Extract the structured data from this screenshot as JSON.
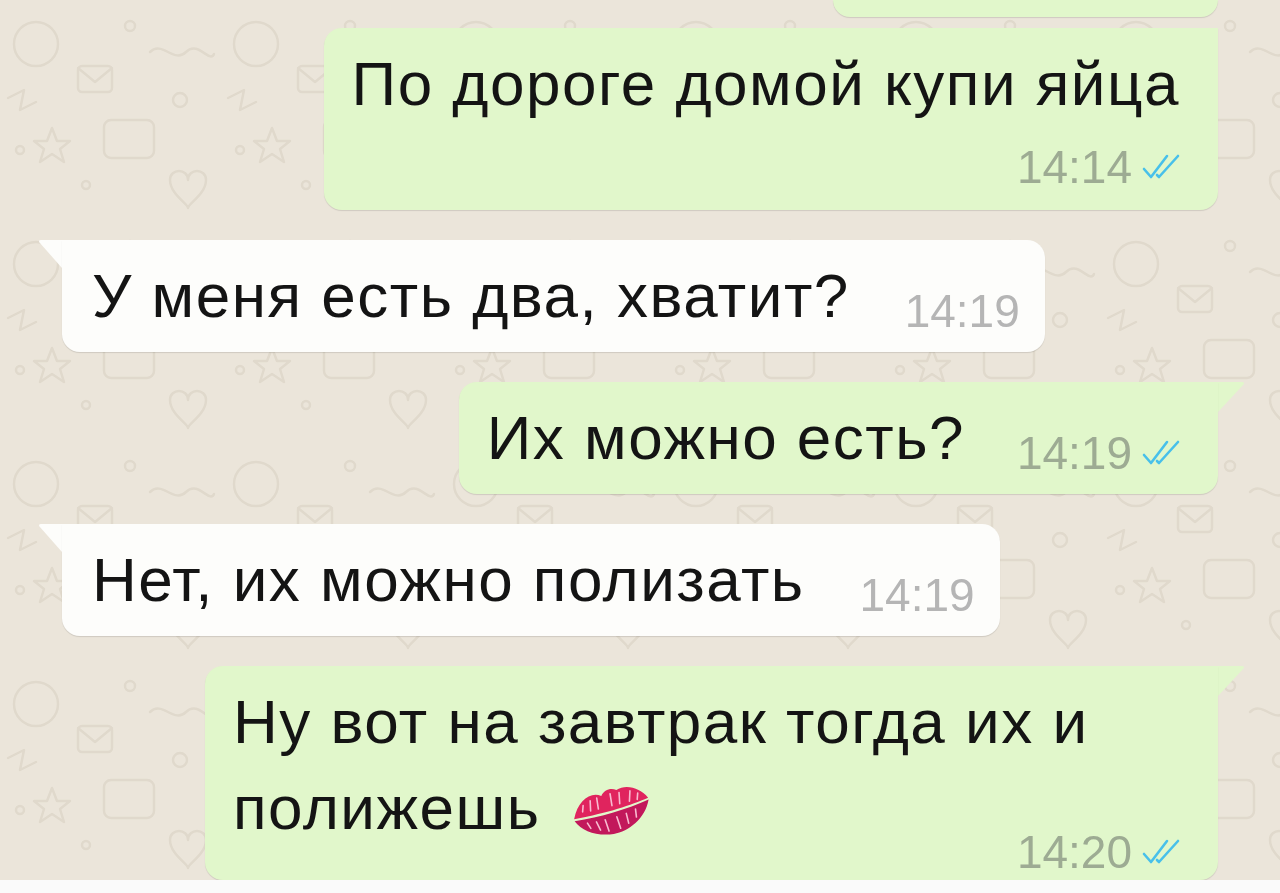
{
  "messages": [
    {
      "kind": "outgoing",
      "cut_off": true
    },
    {
      "kind": "outgoing",
      "cut_off": false,
      "text": "По дороге домой купи яйца",
      "time": "14:14",
      "read": true
    },
    {
      "kind": "incoming",
      "cut_off": false,
      "text": "У меня есть два, хватит?",
      "time": "14:19"
    },
    {
      "kind": "outgoing",
      "cut_off": false,
      "text": "Их можно есть?",
      "time": "14:19",
      "read": true
    },
    {
      "kind": "incoming",
      "cut_off": false,
      "text": "Нет, их можно полизать",
      "time": "14:19"
    },
    {
      "kind": "outgoing",
      "cut_off": false,
      "text": "Ну вот на завтрак тогда их и полижешь",
      "time": "14:20",
      "read": true,
      "emoji": true
    }
  ]
}
